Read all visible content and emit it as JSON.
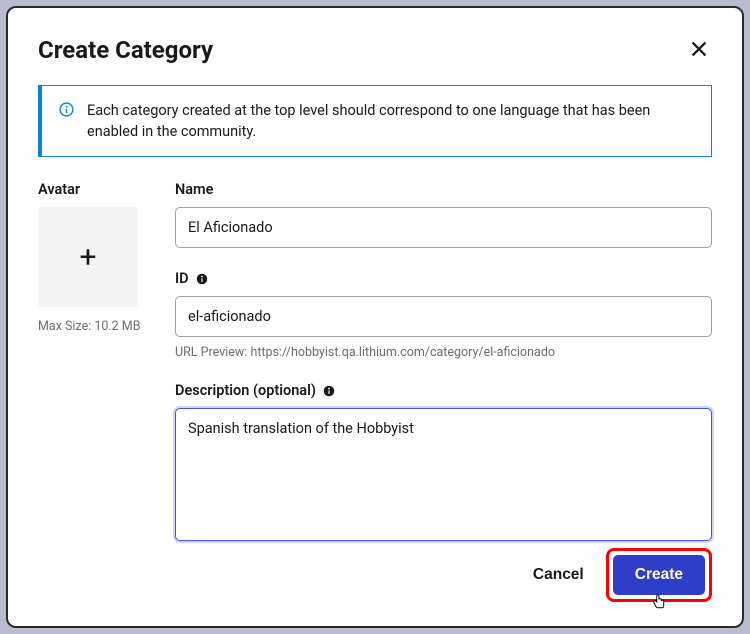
{
  "modal": {
    "title": "Create Category",
    "info_message": "Each category created at the top level should correspond to one language that has been enabled in the community."
  },
  "avatar": {
    "label": "Avatar",
    "glyph": "+",
    "caption": "Max Size: 10.2 MB"
  },
  "fields": {
    "name": {
      "label": "Name",
      "value": "El Aficionado"
    },
    "id": {
      "label": "ID",
      "value": "el-aficionado",
      "hint": "URL Preview: https://hobbyist.qa.lithium.com/category/el-aficionado"
    },
    "description": {
      "label": "Description (optional)",
      "value": "Spanish translation of the Hobbyist"
    }
  },
  "buttons": {
    "cancel": "Cancel",
    "create": "Create"
  }
}
